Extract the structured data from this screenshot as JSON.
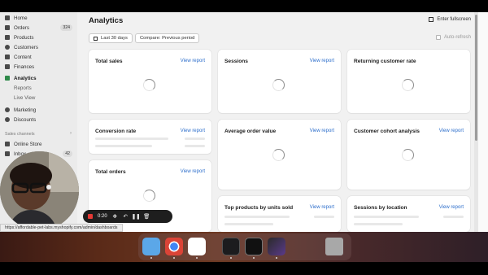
{
  "sidebar": {
    "items": [
      {
        "label": "Home",
        "icon": "home-icon"
      },
      {
        "label": "Orders",
        "icon": "orders-icon",
        "count": "324"
      },
      {
        "label": "Products",
        "icon": "tag-icon"
      },
      {
        "label": "Customers",
        "icon": "person-icon"
      },
      {
        "label": "Content",
        "icon": "content-icon"
      },
      {
        "label": "Finances",
        "icon": "bank-icon"
      },
      {
        "label": "Analytics",
        "icon": "bar-chart-icon"
      },
      {
        "label": "Reports"
      },
      {
        "label": "Live View"
      },
      {
        "label": "Marketing",
        "icon": "target-icon"
      },
      {
        "label": "Discounts",
        "icon": "discount-icon"
      }
    ],
    "sales_channels_label": "Sales channels",
    "channels": [
      {
        "label": "Online Store",
        "icon": "store-icon"
      },
      {
        "label": "Inbox",
        "icon": "inbox-icon",
        "count": "42"
      }
    ]
  },
  "header": {
    "title": "Analytics",
    "fullscreen_label": "Enter fullscreen"
  },
  "filters": {
    "date_range": "Last 30 days",
    "compare": "Compare: Previous period",
    "auto_refresh": "Auto-refresh"
  },
  "cards": [
    {
      "title": "Total sales",
      "link": "View report"
    },
    {
      "title": "Sessions",
      "link": "View report"
    },
    {
      "title": "Returning customer rate",
      "link": ""
    },
    {
      "title": "Conversion rate",
      "link": "View report"
    },
    {
      "title": "Average order value",
      "link": "View report"
    },
    {
      "title": "Customer cohort analysis",
      "link": "View report"
    },
    {
      "title": "Total orders",
      "link": "View report"
    },
    {
      "title": "Top products by units sold",
      "link": "View report"
    },
    {
      "title": "Sessions by location",
      "link": "View report"
    }
  ],
  "recording": {
    "timer": "0:20",
    "accent": "#e53935"
  },
  "status_url": "https://affordable-pet-labs.myshopify.com/admin/dashboards",
  "colors": {
    "link": "#2c6ecb",
    "sidebar_bg": "#ebebeb",
    "page_bg": "#f1f1f1"
  }
}
